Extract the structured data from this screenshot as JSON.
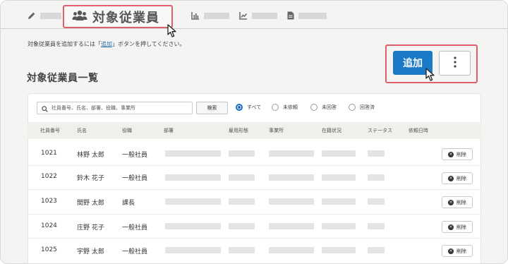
{
  "tabs": {
    "active_label": "対象従業員"
  },
  "description": {
    "prefix": "対象従業員を追加するには「",
    "link": "追加",
    "suffix": "」ボタンを押してください。"
  },
  "page_title": "対象従業員一覧",
  "actions": {
    "add_label": "追加"
  },
  "filters": {
    "search_placeholder": "社員番号、氏名、部署、役職、事業所",
    "search_button": "検索",
    "radios": [
      "すべて",
      "未依頼",
      "未回答",
      "回答済"
    ],
    "selected": "すべて"
  },
  "table": {
    "headers": [
      "社員番号",
      "氏名",
      "役職",
      "部署",
      "雇用形態",
      "事業所",
      "在籍状況",
      "ステータス",
      "依頼日時"
    ],
    "rows": [
      {
        "id": "1021",
        "name": "林野 太郎",
        "title": "一般社員"
      },
      {
        "id": "1022",
        "name": "鈴木 花子",
        "title": "一般社員"
      },
      {
        "id": "1023",
        "name": "間野 太郎",
        "title": "課長"
      },
      {
        "id": "1024",
        "name": "庄野 花子",
        "title": "一般社員"
      },
      {
        "id": "1025",
        "name": "宇野 太郎",
        "title": "一般社員"
      }
    ],
    "delete_label": "削除"
  },
  "colors": {
    "accent": "#1a7ac8",
    "highlight": "#e0606a"
  }
}
